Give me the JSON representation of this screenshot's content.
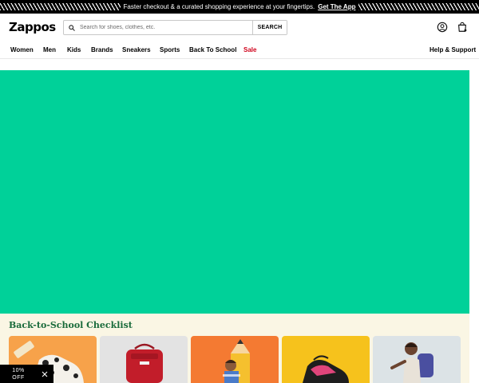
{
  "promo": {
    "text": "Faster checkout & a curated shopping experience at your fingertips.",
    "link_label": "Get The App"
  },
  "header": {
    "logo": "Zappos",
    "search_placeholder": "Search for shoes, clothes, etc.",
    "search_button": "SEARCH",
    "icons": [
      "account-icon",
      "bag-icon"
    ]
  },
  "nav": {
    "items": [
      "Women",
      "Men",
      "Kids",
      "Brands",
      "Sneakers",
      "Sports",
      "Back To School",
      "Sale"
    ],
    "help_label": "Help & Support"
  },
  "colors": {
    "hero_bg": "#00d199",
    "checklist_title": "#1a6b3b",
    "sale": "#d0021b"
  },
  "checklist": {
    "title": "Back-to-School Checklist"
  },
  "discount": {
    "line1": "10%",
    "line2": "OFF"
  }
}
